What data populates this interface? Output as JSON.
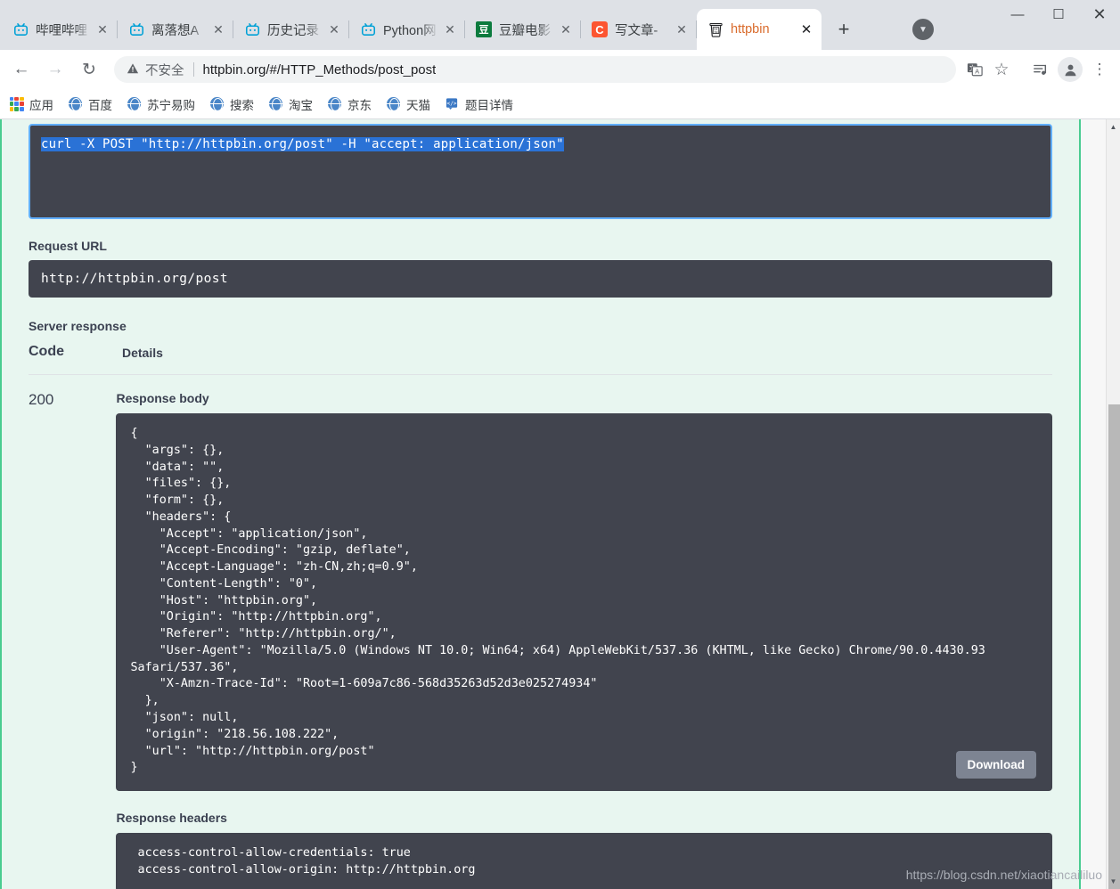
{
  "window": {
    "minimize_label": "—",
    "maximize_label": "☐",
    "close_label": "✕",
    "tab_list_label": "▼"
  },
  "tabs": [
    {
      "title": "哔哩哔哩",
      "favicon": "bilibili-icon",
      "glyph": "📺",
      "active": false,
      "close_label": "✕"
    },
    {
      "title": "离落想A",
      "favicon": "bilibili-icon",
      "glyph": "📺",
      "active": false,
      "close_label": "✕"
    },
    {
      "title": "历史记录",
      "favicon": "bilibili-icon",
      "glyph": "📺",
      "active": false,
      "close_label": "✕"
    },
    {
      "title": "Python网",
      "favicon": "bilibili-icon",
      "glyph": "📺",
      "active": false,
      "close_label": "✕"
    },
    {
      "title": "豆瓣电影",
      "favicon": "douban-icon",
      "glyph": "豆",
      "active": false,
      "close_label": "✕"
    },
    {
      "title": "写文章-",
      "favicon": "csdn-icon",
      "glyph": "C",
      "active": false,
      "close_label": "✕"
    },
    {
      "title": "httpbin",
      "favicon": "httpbin-icon",
      "glyph": "🗑",
      "active": true,
      "close_label": "✕"
    }
  ],
  "newtab_label": "+",
  "toolbar": {
    "back_label": "←",
    "forward_label": "→",
    "reload_label": "↻",
    "warning_label": "⚠",
    "security_text": "不安全",
    "url": "httpbin.org/#/HTTP_Methods/post_post",
    "url_domain": "httpbin.org",
    "url_path": "/#/HTTP_Methods/post_post",
    "translate_label": "文A",
    "bookmark_label": "☆",
    "media_label": "♫",
    "profile_label": "👤",
    "menu_label": "⋮"
  },
  "bookmarks": [
    {
      "label": "应用",
      "icon": "apps-grid-icon"
    },
    {
      "label": "百度",
      "icon": "globe-icon"
    },
    {
      "label": "苏宁易购",
      "icon": "globe-icon"
    },
    {
      "label": "搜索",
      "icon": "globe-icon"
    },
    {
      "label": "淘宝",
      "icon": "globe-icon"
    },
    {
      "label": "京东",
      "icon": "globe-icon"
    },
    {
      "label": "天猫",
      "icon": "globe-icon"
    },
    {
      "label": "题目详情",
      "icon": "doc-icon"
    }
  ],
  "content": {
    "curl_command": "curl -X POST \"http://httpbin.org/post\" -H \"accept: application/json\"",
    "request_url_label": "Request URL",
    "request_url": "http://httpbin.org/post",
    "server_response_label": "Server response",
    "col_code": "Code",
    "col_details": "Details",
    "status_code": "200",
    "response_body_label": "Response body",
    "response_body": "{\n  \"args\": {},\n  \"data\": \"\",\n  \"files\": {},\n  \"form\": {},\n  \"headers\": {\n    \"Accept\": \"application/json\",\n    \"Accept-Encoding\": \"gzip, deflate\",\n    \"Accept-Language\": \"zh-CN,zh;q=0.9\",\n    \"Content-Length\": \"0\",\n    \"Host\": \"httpbin.org\",\n    \"Origin\": \"http://httpbin.org\",\n    \"Referer\": \"http://httpbin.org/\",\n    \"User-Agent\": \"Mozilla/5.0 (Windows NT 10.0; Win64; x64) AppleWebKit/537.36 (KHTML, like Gecko) Chrome/90.0.4430.93 Safari/537.36\",\n    \"X-Amzn-Trace-Id\": \"Root=1-609a7c86-568d35263d52d3e025274934\"\n  },\n  \"json\": null,\n  \"origin\": \"218.56.108.222\",\n  \"url\": \"http://httpbin.org/post\"\n}",
    "download_label": "Download",
    "response_headers_label": "Response headers",
    "response_headers": " access-control-allow-credentials: true\n access-control-allow-origin: http://httpbin.org"
  },
  "watermark": "https://blog.csdn.net/xiaotiancaililuo",
  "scrollbar": {
    "up_label": "▲",
    "down_label": "▼"
  }
}
